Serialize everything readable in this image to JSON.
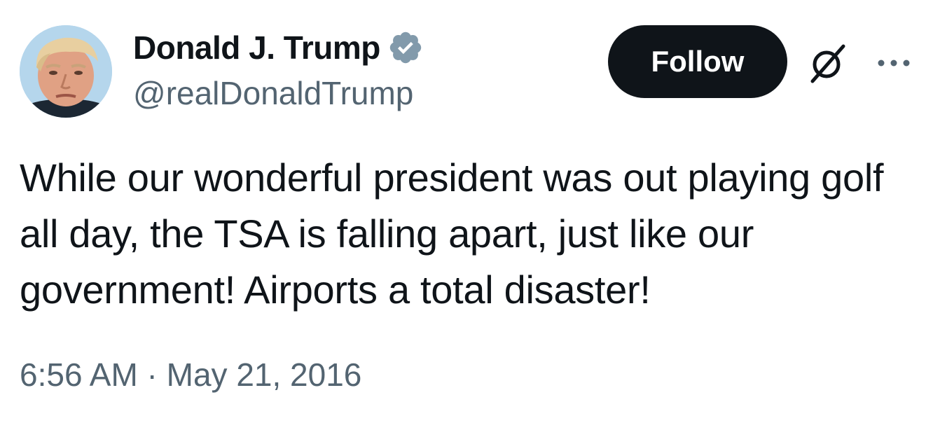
{
  "author": {
    "display_name": "Donald J. Trump",
    "handle": "@realDonaldTrump",
    "verified": true,
    "verified_color": "#829aab"
  },
  "actions": {
    "follow_label": "Follow",
    "grok_icon": "grok-icon",
    "more_icon": "more-options-icon"
  },
  "tweet": {
    "text": "While our wonderful president was out playing golf all day, the TSA is falling apart, just like our government! Airports a total disaster!",
    "timestamp": "6:56 AM · May 21, 2016"
  },
  "colors": {
    "text_primary": "#0f1419",
    "text_secondary": "#536471",
    "button_bg": "#0f1419",
    "button_text": "#ffffff"
  }
}
